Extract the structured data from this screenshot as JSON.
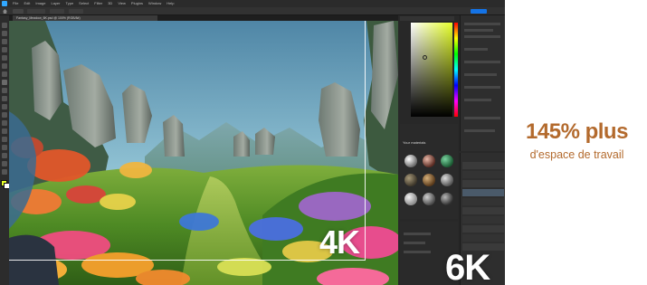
{
  "app": {
    "menu_items": [
      "File",
      "Edit",
      "Image",
      "Layer",
      "Type",
      "Select",
      "Filter",
      "3D",
      "View",
      "Plugins",
      "Window",
      "Help"
    ],
    "document_tab": "Fantasy_Meadow_6K.psd @ 100% (RGB/8#)"
  },
  "labels": {
    "res_4k": "4K",
    "res_6k": "6K"
  },
  "panel": {
    "materials_heading": "Your materials",
    "material_count": 9,
    "color_picker_hue": "#e6ff2a"
  },
  "marketing": {
    "headline": "145% plus",
    "subline": "d'espace de travail"
  },
  "colors": {
    "brand": "#b36a2d",
    "ui_dark": "#1e1e1e",
    "panel_bg": "#282828"
  }
}
